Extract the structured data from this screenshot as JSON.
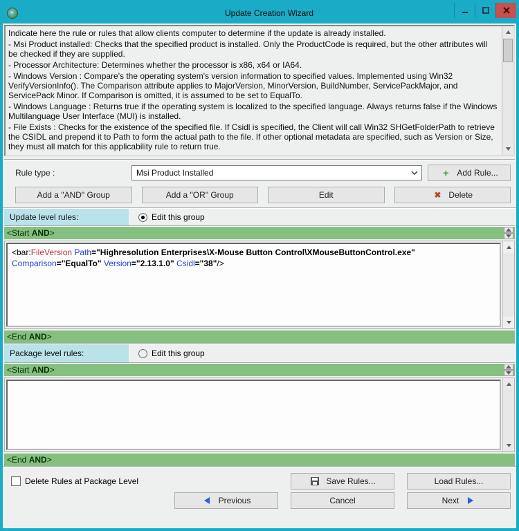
{
  "title": "Update Creation Wizard",
  "instructions": {
    "heading": "Indicate here the rule or rules that allow clients computer to determine if the update is already installed.",
    "bullets": [
      " - Msi Product installed: Checks that the specified product is installed. Only the ProductCode is required, but the other attributes will be checked if they are supplied.",
      " - Processor Architecture: Determines whether the processor is x86, x64 or IA64.",
      " - Windows Version : Compare's the operating system's version information to specified values.  Implemented using Win32 VerifyVersionInfo().  The Comparison attribute applies to MajorVersion, MinorVersion, BuildNumber, ServicePackMajor, and ServicePack Minor.  If Comparison is omitted, it is assumed to be set to EqualTo.",
      " - Windows Language : Returns true if the operating system is localized to the specified language.  Always returns false if the Windows Multilanguage User Interface (MUI) is installed.",
      " - File Exists : Checks for the existence of the specified file.  If Csidl is specified, the Client will call Win32 SHGetFolderPath to retrieve the CSIDL and prepend it to Path to form the actual path to the file. If other optional metadata are specified, such as Version or Size, they must all match for this applicability rule to return true."
    ]
  },
  "toolbar": {
    "rule_type_label": "Rule type :",
    "rule_type_value": "Msi Product Installed",
    "add_rule": "Add Rule...",
    "add_and_group": "Add a \"AND\" Group",
    "add_or_group": "Add a \"OR\" Group",
    "edit": "Edit",
    "delete": "Delete"
  },
  "levels": {
    "update_label": "Update level rules:",
    "package_label": "Package level rules:",
    "edit_group": "Edit this group"
  },
  "bands": {
    "start_prefix": "<Start ",
    "end_prefix": "<End ",
    "op": "AND",
    "suffix": ">"
  },
  "rule1": {
    "prefix": "<bar:",
    "element": "FileVersion",
    "attr_path_name": " Path",
    "attr_path_val": "=\"Highresolution Enterprises\\X-Mouse Button Control\\XMouseButtonControl.exe\"",
    "attr_comp_name": "Comparison",
    "attr_comp_val": "=\"EqualTo\"",
    "attr_ver_name": " Version",
    "attr_ver_val": "=\"2.13.1.0\"",
    "attr_csidl_name": " Csidl",
    "attr_csidl_val": "=\"38\"",
    "close": "/>"
  },
  "footer": {
    "delete_at_pkg": "Delete Rules at Package Level",
    "save_rules": "Save Rules...",
    "load_rules": "Load Rules...",
    "previous": "Previous",
    "cancel": "Cancel",
    "next": "Next"
  }
}
